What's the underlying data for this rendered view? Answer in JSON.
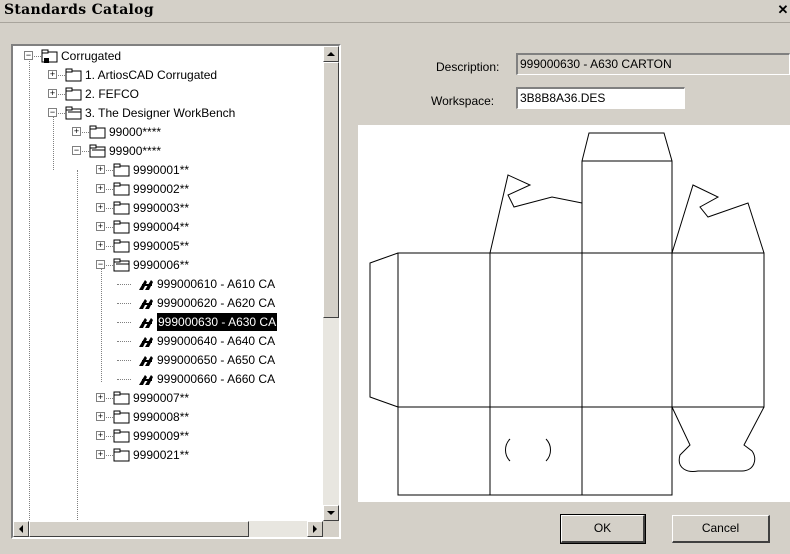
{
  "window": {
    "title": "Standards Catalog",
    "close_glyph": "✕"
  },
  "tree": {
    "nodes": [
      {
        "label": "Corrugated",
        "level": 0,
        "toggle": "−",
        "icon": "folder-network-icon"
      },
      {
        "label": "1. ArtiosCAD Corrugated",
        "level": 1,
        "toggle": "+",
        "icon": "folder-icon"
      },
      {
        "label": "2. FEFCO",
        "level": 1,
        "toggle": "+",
        "icon": "folder-icon"
      },
      {
        "label": "3. The Designer WorkBench",
        "level": 1,
        "toggle": "−",
        "icon": "folder-open-icon"
      },
      {
        "label": "99000****",
        "level": 2,
        "toggle": "+",
        "icon": "folder-icon"
      },
      {
        "label": "99900****",
        "level": 2,
        "toggle": "−",
        "icon": "folder-open-icon"
      },
      {
        "label": "9990001**",
        "level": 3,
        "toggle": "+",
        "icon": "folder-icon"
      },
      {
        "label": "9990002**",
        "level": 3,
        "toggle": "+",
        "icon": "folder-icon"
      },
      {
        "label": "9990003**",
        "level": 3,
        "toggle": "+",
        "icon": "folder-icon"
      },
      {
        "label": "9990004**",
        "level": 3,
        "toggle": "+",
        "icon": "folder-icon"
      },
      {
        "label": "9990005**",
        "level": 3,
        "toggle": "+",
        "icon": "folder-icon"
      },
      {
        "label": "9990006**",
        "level": 3,
        "toggle": "−",
        "icon": "folder-open-icon"
      },
      {
        "label": "999000610 - A610 CA",
        "level": 4,
        "toggle": "",
        "icon": "design-icon"
      },
      {
        "label": "999000620 - A620 CA",
        "level": 4,
        "toggle": "",
        "icon": "design-icon"
      },
      {
        "label": "999000630 - A630 CA",
        "level": 4,
        "toggle": "",
        "icon": "design-icon",
        "selected": true
      },
      {
        "label": "999000640 - A640 CA",
        "level": 4,
        "toggle": "",
        "icon": "design-icon"
      },
      {
        "label": "999000650 - A650 CA",
        "level": 4,
        "toggle": "",
        "icon": "design-icon"
      },
      {
        "label": "999000660 - A660 CA",
        "level": 4,
        "toggle": "",
        "icon": "design-icon"
      },
      {
        "label": "9990007**",
        "level": 3,
        "toggle": "+",
        "icon": "folder-icon"
      },
      {
        "label": "9990008**",
        "level": 3,
        "toggle": "+",
        "icon": "folder-icon"
      },
      {
        "label": "9990009**",
        "level": 3,
        "toggle": "+",
        "icon": "folder-icon"
      },
      {
        "label": "9990021**",
        "level": 3,
        "toggle": "+",
        "icon": "folder-icon"
      }
    ]
  },
  "description": {
    "label": "Description:",
    "value": "999000630 - A630 CARTON"
  },
  "workspace": {
    "label": "Workspace:",
    "value": "3B8B8A36.DES"
  },
  "buttons": {
    "ok": "OK",
    "cancel": "Cancel"
  },
  "colors": {
    "selection_bg": "#000000",
    "dialog_bg": "#d4d0c8",
    "preview_bg": "#ffffff"
  }
}
